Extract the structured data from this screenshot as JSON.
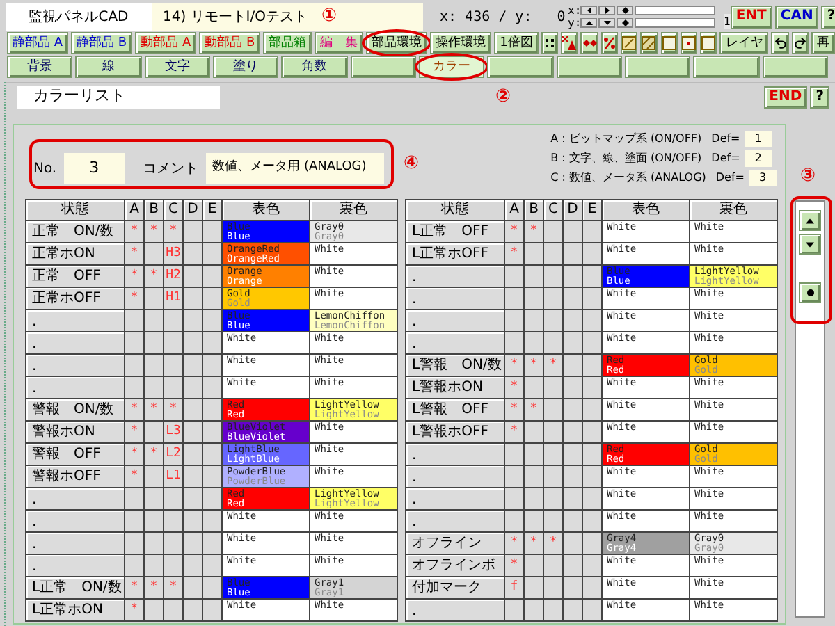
{
  "title_bar": {
    "app_title": "監視パネルCAD",
    "document": "14) リモートI/Oテスト",
    "marker": "①",
    "coords": "x: 436 / y:   0",
    "xy_labels": [
      "x:",
      "y:"
    ],
    "zoom": "1",
    "buttons": [
      {
        "label": "ENT",
        "color": "#e00000"
      },
      {
        "label": "CAN",
        "color": "#0000cc"
      },
      {
        "label": "?",
        "color": "#000000"
      }
    ]
  },
  "toolbar": [
    {
      "kind": "text",
      "label": "静部品 A",
      "color": "#0000cc",
      "circled": false
    },
    {
      "kind": "text",
      "label": "静部品 B",
      "color": "#0000cc",
      "circled": false
    },
    {
      "kind": "text",
      "label": "動部品 A",
      "color": "#e00000",
      "circled": false
    },
    {
      "kind": "text",
      "label": "動部品 B",
      "color": "#e00000",
      "circled": false
    },
    {
      "kind": "text",
      "label": "部品箱",
      "color": "#008000",
      "circled": false
    },
    {
      "kind": "text",
      "label": "編　集",
      "color": "#e0007f",
      "circled": false
    },
    {
      "kind": "text",
      "label": "部品環境",
      "color": "#000000",
      "circled": true
    },
    {
      "kind": "text",
      "label": "操作環境",
      "color": "#000000",
      "circled": false
    },
    {
      "kind": "text",
      "label": "1倍図",
      "color": "#000000",
      "circled": false
    },
    {
      "kind": "dots"
    },
    {
      "kind": "xa"
    },
    {
      "kind": "diamonds"
    },
    {
      "kind": "percent"
    },
    {
      "kind": "hatch"
    },
    {
      "kind": "hatch2"
    },
    {
      "kind": "square"
    },
    {
      "kind": "dotsquare"
    },
    {
      "kind": "square"
    },
    {
      "kind": "text",
      "label": "レイヤ",
      "color": "#000000",
      "circled": false
    },
    {
      "kind": "undo"
    },
    {
      "kind": "redo"
    },
    {
      "kind": "text",
      "label": "再",
      "color": "#000000",
      "circled": false
    }
  ],
  "tabs": [
    {
      "label": "背景",
      "selected": false
    },
    {
      "label": "線",
      "selected": false
    },
    {
      "label": "文字",
      "selected": false
    },
    {
      "label": "塗り",
      "selected": false
    },
    {
      "label": "角数",
      "selected": false
    },
    {
      "selected": false
    },
    {
      "label": "カラー",
      "selected": true,
      "circled": true
    },
    {
      "selected": false
    },
    {
      "selected": false
    },
    {
      "selected": false
    },
    {
      "selected": false
    },
    {
      "selected": false
    }
  ],
  "panel": {
    "title": "カラーリスト",
    "marker": "②",
    "buttons": [
      {
        "label": "END",
        "color": "#e00000"
      },
      {
        "label": "?",
        "color": "#000000"
      }
    ]
  },
  "form": {
    "highlighted": true,
    "marker": "④",
    "no_label": "No.",
    "no_value": "3",
    "comment_label": "コメント",
    "comment_value": "数値、メータ用 (ANALOG)"
  },
  "legend": [
    {
      "text": "A : ビットマップ系 (ON/OFF)",
      "def_label": "Def=",
      "def": "1"
    },
    {
      "text": "B : 文字、線、塗面 (ON/OFF)",
      "def_label": "Def=",
      "def": "2"
    },
    {
      "text": "C : 数値、メータ系 (ANALOG)",
      "def_label": "Def=",
      "def": "3"
    }
  ],
  "tables": [
    {
      "columns": [
        "状態",
        "A",
        "B",
        "C",
        "D",
        "E",
        "表色",
        "裏色"
      ],
      "rows": [
        {
          "state": "正常　ON/数",
          "a": "*",
          "b": "*",
          "c": "*",
          "front": {
            "color": "#0000ff",
            "lines": [
              "Blue",
              "Blue"
            ]
          },
          "back": {
            "color": "#e8e8e8",
            "lines": [
              "Gray0",
              "Gray0"
            ]
          }
        },
        {
          "state": "正常ホON",
          "a": "*",
          "c": "H3",
          "front": {
            "color": "#ff5000",
            "lines": [
              "OrangeRed",
              "OrangeRed"
            ]
          },
          "back": {
            "color": "#ffffff",
            "lines": [
              "White"
            ]
          }
        },
        {
          "state": "正常　OFF",
          "a": "*",
          "b": "*",
          "c": "H2",
          "front": {
            "color": "#ff8000",
            "lines": [
              "Orange",
              "Orange"
            ]
          },
          "back": {
            "color": "#ffffff",
            "lines": [
              "White"
            ]
          }
        },
        {
          "state": "正常ホOFF",
          "a": "*",
          "c": "H1",
          "front": {
            "color": "#ffc800",
            "lines": [
              "Gold",
              "Gold"
            ]
          },
          "back": {
            "color": "#ffffff",
            "lines": [
              "White"
            ]
          }
        },
        {
          "state": ".",
          "front": {
            "color": "#0000ff",
            "lines": [
              "Blue",
              "Blue"
            ]
          },
          "back": {
            "color": "#ffffc0",
            "lines": [
              "LemonChiffon",
              "LemonChiffon"
            ]
          }
        },
        {
          "state": ".",
          "front": {
            "color": "#ffffff",
            "lines": [
              "White"
            ]
          },
          "back": {
            "color": "#ffffff",
            "lines": [
              "White"
            ]
          }
        },
        {
          "state": ".",
          "front": {
            "color": "#ffffff",
            "lines": [
              "White"
            ]
          },
          "back": {
            "color": "#ffffff",
            "lines": [
              "White"
            ]
          }
        },
        {
          "state": ".",
          "front": {
            "color": "#ffffff",
            "lines": [
              "White"
            ]
          },
          "back": {
            "color": "#ffffff",
            "lines": [
              "White"
            ]
          }
        },
        {
          "state": "警報　ON/数",
          "a": "*",
          "b": "*",
          "c": "*",
          "front": {
            "color": "#ff0000",
            "lines": [
              "Red",
              "Red"
            ]
          },
          "back": {
            "color": "#ffff66",
            "lines": [
              "LightYellow",
              "LightYellow"
            ]
          }
        },
        {
          "state": "警報ホON",
          "a": "*",
          "c": "L3",
          "front": {
            "color": "#6600cc",
            "lines": [
              "BlueViolet",
              "BlueViolet"
            ]
          },
          "back": {
            "color": "#ffffff",
            "lines": [
              "White"
            ]
          }
        },
        {
          "state": "警報　OFF",
          "a": "*",
          "b": "*",
          "c": "L2",
          "front": {
            "color": "#6666ff",
            "lines": [
              "LightBlue",
              "LightBlue"
            ]
          },
          "back": {
            "color": "#ffffff",
            "lines": [
              "White"
            ]
          }
        },
        {
          "state": "警報ホOFF",
          "a": "*",
          "c": "L1",
          "front": {
            "color": "#b0b0ff",
            "lines": [
              "PowderBlue",
              "PowderBlue"
            ]
          },
          "back": {
            "color": "#ffffff",
            "lines": [
              "White"
            ]
          }
        },
        {
          "state": ".",
          "front": {
            "color": "#ff0000",
            "lines": [
              "Red",
              "Red"
            ]
          },
          "back": {
            "color": "#ffff66",
            "lines": [
              "LightYellow",
              "LightYellow"
            ]
          }
        },
        {
          "state": ".",
          "front": {
            "color": "#ffffff",
            "lines": [
              "White"
            ]
          },
          "back": {
            "color": "#ffffff",
            "lines": [
              "White"
            ]
          }
        },
        {
          "state": ".",
          "front": {
            "color": "#ffffff",
            "lines": [
              "White"
            ]
          },
          "back": {
            "color": "#ffffff",
            "lines": [
              "White"
            ]
          }
        },
        {
          "state": ".",
          "front": {
            "color": "#ffffff",
            "lines": [
              "White"
            ]
          },
          "back": {
            "color": "#ffffff",
            "lines": [
              "White"
            ]
          }
        },
        {
          "state": "L正常　ON/数",
          "a": "*",
          "b": "*",
          "c": "*",
          "front": {
            "color": "#0000ff",
            "lines": [
              "Blue",
              "Blue"
            ]
          },
          "back": {
            "color": "#d4d4d4",
            "lines": [
              "Gray1",
              "Gray1"
            ]
          }
        },
        {
          "state": "L正常ホON",
          "a": "*",
          "front": {
            "color": "#ffffff",
            "lines": [
              "White"
            ]
          },
          "back": {
            "color": "#ffffff",
            "lines": [
              "White"
            ]
          }
        }
      ]
    },
    {
      "columns": [
        "状態",
        "A",
        "B",
        "C",
        "D",
        "E",
        "表色",
        "裏色"
      ],
      "rows": [
        {
          "state": "L正常　OFF",
          "a": "*",
          "b": "*",
          "front": {
            "color": "#ffffff",
            "lines": [
              "White"
            ]
          },
          "back": {
            "color": "#ffffff",
            "lines": [
              "White"
            ]
          }
        },
        {
          "state": "L正常ホOFF",
          "a": "*",
          "front": {
            "color": "#ffffff",
            "lines": [
              "White"
            ]
          },
          "back": {
            "color": "#ffffff",
            "lines": [
              "White"
            ]
          }
        },
        {
          "state": ".",
          "front": {
            "color": "#0000ff",
            "lines": [
              "Blue",
              "Blue"
            ]
          },
          "back": {
            "color": "#ffff66",
            "lines": [
              "LightYellow",
              "LightYellow"
            ]
          }
        },
        {
          "state": ".",
          "front": {
            "color": "#ffffff",
            "lines": [
              "White"
            ]
          },
          "back": {
            "color": "#ffffff",
            "lines": [
              "White"
            ]
          }
        },
        {
          "state": ".",
          "front": {
            "color": "#ffffff",
            "lines": [
              "White"
            ]
          },
          "back": {
            "color": "#ffffff",
            "lines": [
              "White"
            ]
          }
        },
        {
          "state": ".",
          "front": {
            "color": "#ffffff",
            "lines": [
              "White"
            ]
          },
          "back": {
            "color": "#ffffff",
            "lines": [
              "White"
            ]
          }
        },
        {
          "state": "L警報　ON/数",
          "a": "*",
          "b": "*",
          "c": "*",
          "front": {
            "color": "#ff0000",
            "lines": [
              "Red",
              "Red"
            ]
          },
          "back": {
            "color": "#ffc000",
            "lines": [
              "Gold",
              "Gold"
            ]
          }
        },
        {
          "state": "L警報ホON",
          "a": "*",
          "front": {
            "color": "#ffffff",
            "lines": [
              "White"
            ]
          },
          "back": {
            "color": "#ffffff",
            "lines": [
              "White"
            ]
          }
        },
        {
          "state": "L警報　OFF",
          "a": "*",
          "b": "*",
          "front": {
            "color": "#ffffff",
            "lines": [
              "White"
            ]
          },
          "back": {
            "color": "#ffffff",
            "lines": [
              "White"
            ]
          }
        },
        {
          "state": "L警報ホOFF",
          "a": "*",
          "front": {
            "color": "#ffffff",
            "lines": [
              "White"
            ]
          },
          "back": {
            "color": "#ffffff",
            "lines": [
              "White"
            ]
          }
        },
        {
          "state": ".",
          "front": {
            "color": "#ff0000",
            "lines": [
              "Red",
              "Red"
            ]
          },
          "back": {
            "color": "#ffc000",
            "lines": [
              "Gold",
              "Gold"
            ]
          }
        },
        {
          "state": ".",
          "front": {
            "color": "#ffffff",
            "lines": [
              "White"
            ]
          },
          "back": {
            "color": "#ffffff",
            "lines": [
              "White"
            ]
          }
        },
        {
          "state": ".",
          "front": {
            "color": "#ffffff",
            "lines": [
              "White"
            ]
          },
          "back": {
            "color": "#ffffff",
            "lines": [
              "White"
            ]
          }
        },
        {
          "state": ".",
          "front": {
            "color": "#ffffff",
            "lines": [
              "White"
            ]
          },
          "back": {
            "color": "#ffffff",
            "lines": [
              "White"
            ]
          }
        },
        {
          "state": "オフライン",
          "a": "*",
          "b": "*",
          "c": "*",
          "front": {
            "color": "#a0a0a0",
            "lines": [
              "Gray4",
              "Gray4"
            ]
          },
          "back": {
            "color": "#e8e8e8",
            "lines": [
              "Gray0",
              "Gray0"
            ]
          }
        },
        {
          "state": "オフラインボ",
          "a": "*",
          "front": {
            "color": "#ffffff",
            "lines": [
              "White"
            ]
          },
          "back": {
            "color": "#ffffff",
            "lines": [
              "White"
            ]
          }
        },
        {
          "state": "付加マーク",
          "a": "f",
          "front": {
            "color": "#ffffff",
            "lines": [
              "White"
            ]
          },
          "back": {
            "color": "#ffffff",
            "lines": [
              "White"
            ]
          }
        },
        {
          "state": ".",
          "front": {
            "color": "#ffffff",
            "lines": [
              "White"
            ]
          },
          "back": {
            "color": "#ffffff",
            "lines": [
              "White"
            ]
          }
        }
      ]
    }
  ],
  "scrollbar": {
    "highlighted": true,
    "marker": "③"
  }
}
